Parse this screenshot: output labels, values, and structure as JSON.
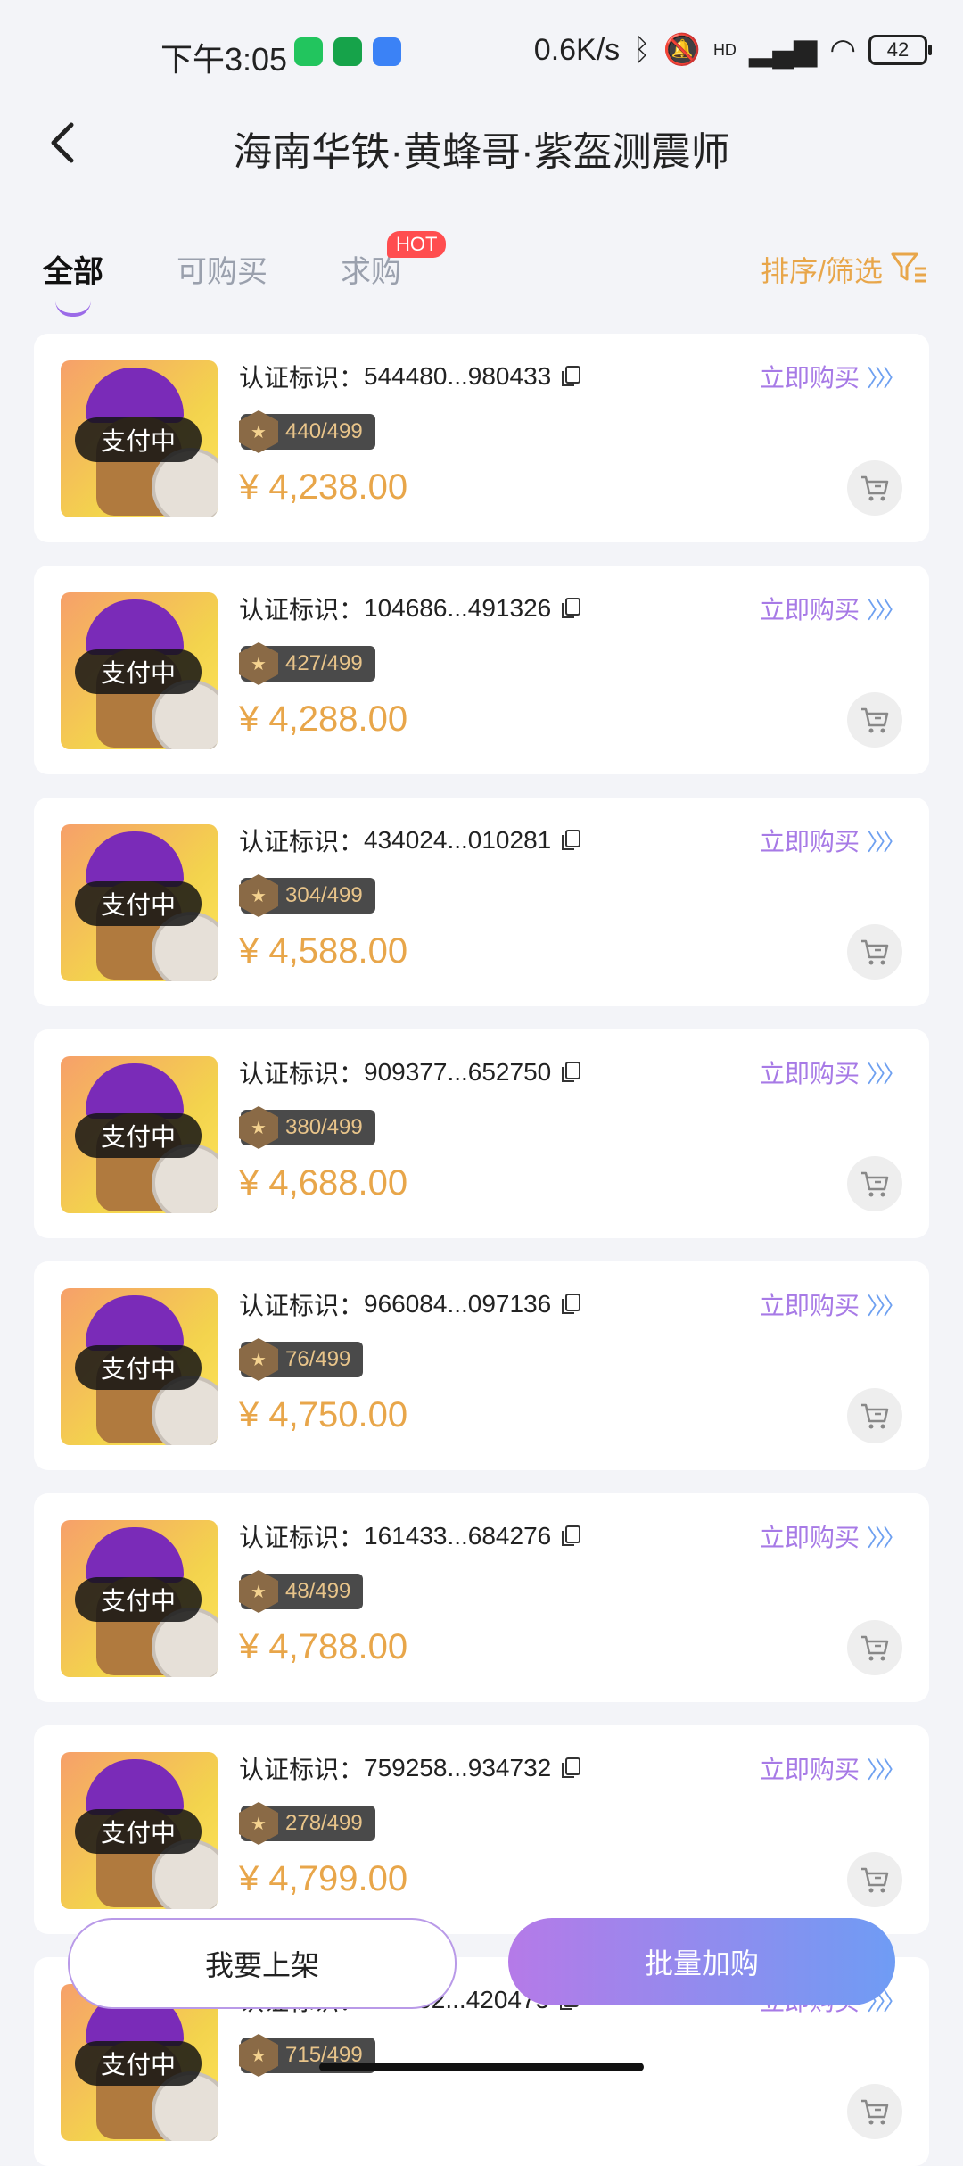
{
  "status_bar": {
    "time": "下午3:05",
    "network_speed": "0.6K/s",
    "battery": "42",
    "signal_label": "HD"
  },
  "header": {
    "title": "海南华铁·黄蜂哥·紫盔测震师"
  },
  "tabs": {
    "items": [
      "全部",
      "可购买",
      "求购"
    ],
    "hot_badge": "HOT",
    "sort_filter": "排序/筛选"
  },
  "items": [
    {
      "cert_label": "认证标识：",
      "cert_id": "544480...980433",
      "edition": "440/499",
      "price": "¥ 4,238.00",
      "status": "支付中",
      "buy_label": "立即购买"
    },
    {
      "cert_label": "认证标识：",
      "cert_id": "104686...491326",
      "edition": "427/499",
      "price": "¥ 4,288.00",
      "status": "支付中",
      "buy_label": "立即购买"
    },
    {
      "cert_label": "认证标识：",
      "cert_id": "434024...010281",
      "edition": "304/499",
      "price": "¥ 4,588.00",
      "status": "支付中",
      "buy_label": "立即购买"
    },
    {
      "cert_label": "认证标识：",
      "cert_id": "909377...652750",
      "edition": "380/499",
      "price": "¥ 4,688.00",
      "status": "支付中",
      "buy_label": "立即购买"
    },
    {
      "cert_label": "认证标识：",
      "cert_id": "966084...097136",
      "edition": "76/499",
      "price": "¥ 4,750.00",
      "status": "支付中",
      "buy_label": "立即购买"
    },
    {
      "cert_label": "认证标识：",
      "cert_id": "161433...684276",
      "edition": "48/499",
      "price": "¥ 4,788.00",
      "status": "支付中",
      "buy_label": "立即购买"
    },
    {
      "cert_label": "认证标识：",
      "cert_id": "759258...934732",
      "edition": "278/499",
      "price": "¥ 4,799.00",
      "status": "支付中",
      "buy_label": "立即购买"
    },
    {
      "cert_label": "认证标识：",
      "cert_id": "112752...420475",
      "edition": "715/499",
      "price": "",
      "status": "支付中",
      "buy_label": "立即购买"
    }
  ],
  "bottom": {
    "list_button": "我要上架",
    "batch_button": "批量加购"
  },
  "colors": {
    "accent_price": "#e8a64a",
    "buy_purple": "#a77ae6",
    "gradient_start": "#b57ae8",
    "gradient_end": "#6f9cf4"
  }
}
